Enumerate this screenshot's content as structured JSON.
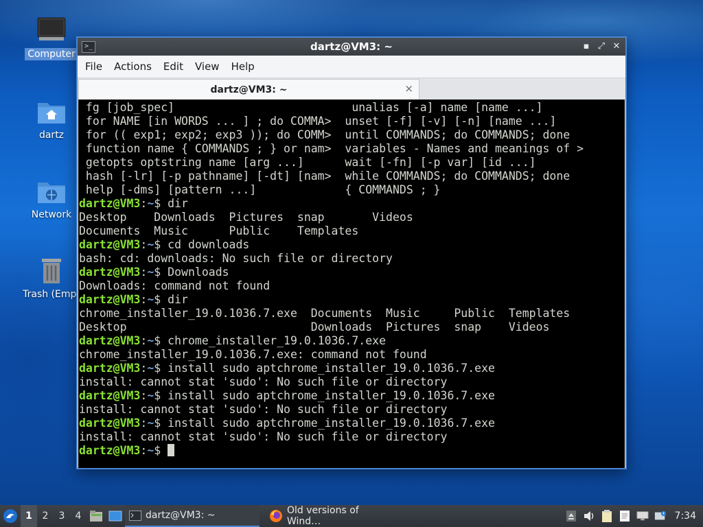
{
  "desktop": {
    "icons": [
      {
        "label": "Computer"
      },
      {
        "label": "dartz"
      },
      {
        "label": "Network"
      },
      {
        "label": "Trash (Empt"
      }
    ]
  },
  "window": {
    "title": "dartz@VM3: ~",
    "menu": [
      "File",
      "Actions",
      "Edit",
      "View",
      "Help"
    ],
    "tab_title": "dartz@VM3: ~",
    "tab_close": "×",
    "buttons": {
      "minimize": "▪",
      "maximize": "⤢",
      "close": "✕"
    }
  },
  "terminal": {
    "prompt_user": "dartz@VM3",
    "prompt_sep": ":",
    "prompt_path": "~",
    "prompt_end": "$ ",
    "help_rows": [
      " fg [job_spec]                          unalias [-a] name [name ...]",
      " for NAME [in WORDS ... ] ; do COMMA>  unset [-f] [-v] [-n] [name ...]",
      " for (( exp1; exp2; exp3 )); do COMM>  until COMMANDS; do COMMANDS; done",
      " function name { COMMANDS ; } or nam>  variables - Names and meanings of >",
      " getopts optstring name [arg ...]      wait [-fn] [-p var] [id ...]",
      " hash [-lr] [-p pathname] [-dt] [nam>  while COMMANDS; do COMMANDS; done",
      " help [-dms] [pattern ...]             { COMMANDS ; }"
    ],
    "session": [
      {
        "type": "cmd",
        "text": "dir"
      },
      {
        "type": "out",
        "text": "Desktop    Downloads  Pictures  snap       Videos"
      },
      {
        "type": "out",
        "text": "Documents  Music      Public    Templates"
      },
      {
        "type": "cmd",
        "text": "cd downloads"
      },
      {
        "type": "out",
        "text": "bash: cd: downloads: No such file or directory"
      },
      {
        "type": "cmd",
        "text": "Downloads"
      },
      {
        "type": "out",
        "text": "Downloads: command not found"
      },
      {
        "type": "cmd",
        "text": "dir"
      },
      {
        "type": "out",
        "text": "chrome_installer_19.0.1036.7.exe  Documents  Music     Public  Templates"
      },
      {
        "type": "out",
        "text": "Desktop                           Downloads  Pictures  snap    Videos"
      },
      {
        "type": "cmd",
        "text": "chrome_installer_19.0.1036.7.exe"
      },
      {
        "type": "out",
        "text": "chrome_installer_19.0.1036.7.exe: command not found"
      },
      {
        "type": "cmd",
        "text": "install sudo aptchrome_installer_19.0.1036.7.exe"
      },
      {
        "type": "out",
        "text": "install: cannot stat 'sudo': No such file or directory"
      },
      {
        "type": "cmd",
        "text": "install sudo aptchrome_installer_19.0.1036.7.exe"
      },
      {
        "type": "out",
        "text": "install: cannot stat 'sudo': No such file or directory"
      },
      {
        "type": "cmd",
        "text": "install sudo aptchrome_installer_19.0.1036.7.exe"
      },
      {
        "type": "out",
        "text": "install: cannot stat 'sudo': No such file or directory"
      }
    ]
  },
  "taskbar": {
    "workspaces": [
      "1",
      "2",
      "3",
      "4"
    ],
    "tasks": [
      {
        "label": "dartz@VM3: ~",
        "icon": "terminal-icon"
      },
      {
        "label": "Old versions of Wind…",
        "icon": "firefox-icon"
      }
    ],
    "clock": "7:34"
  },
  "colors": {
    "prompt_user": "#8ae234",
    "prompt_path": "#729fcf",
    "window_border": "#4a86d2"
  }
}
